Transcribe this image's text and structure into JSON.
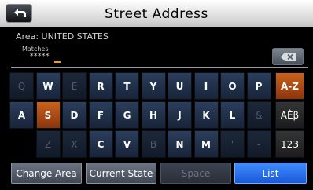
{
  "header": {
    "title": "Street Address"
  },
  "area": {
    "text": "Area: UNITED STATES"
  },
  "input": {
    "matches_label": "Matches",
    "value": "*****"
  },
  "keyboard": {
    "rows": [
      [
        "Q",
        "W",
        "E",
        "R",
        "T",
        "Y",
        "U",
        "I",
        "O",
        "P"
      ],
      [
        "A",
        "S",
        "D",
        "F",
        "G",
        "H",
        "J",
        "K",
        "L",
        "&"
      ],
      [
        "Z",
        "X",
        "C",
        "V",
        "B",
        "N",
        "M",
        "'",
        "-"
      ]
    ],
    "dimmed": [
      "Q",
      "E",
      "&",
      "Z",
      "X",
      "B",
      "'",
      "-"
    ],
    "selected": "S",
    "modes": [
      {
        "label": "A-Z",
        "active": true
      },
      {
        "label": "AÈβ",
        "active": false
      },
      {
        "label": "123",
        "active": false
      }
    ]
  },
  "buttons": {
    "change_area": "Change Area",
    "current_state": "Current State",
    "space": "Space",
    "list": "List"
  },
  "colors": {
    "accent_orange": "#c9621c",
    "key_blue": "#2b3e5c",
    "list_blue": "#2d72f0"
  }
}
